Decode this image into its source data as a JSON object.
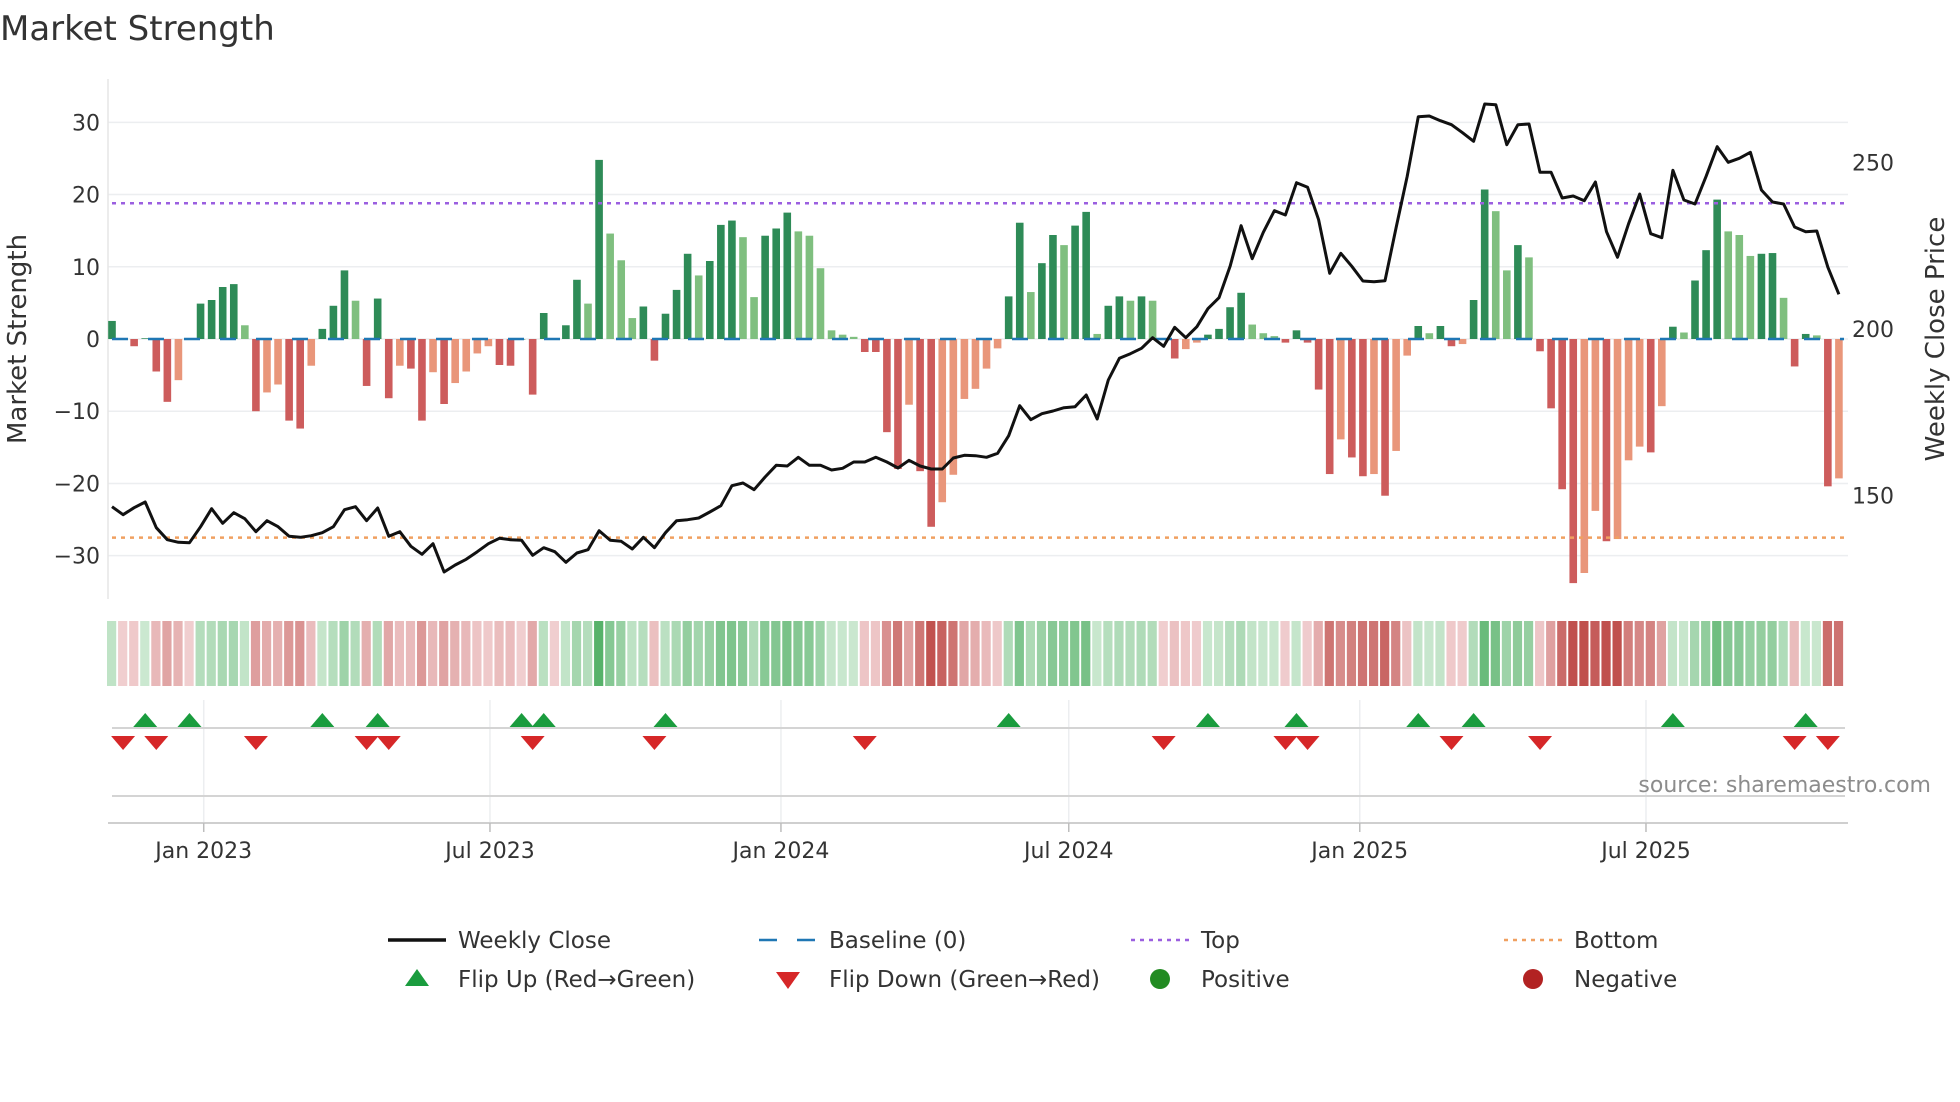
{
  "title": "Market Strength",
  "source": "source: sharemaestro.com",
  "chart_data": {
    "type": "bar",
    "title": "Market Strength",
    "start_date": "2022-11-04",
    "frequency": "weekly",
    "ylabel": "Market Strength",
    "y2label": "Weekly Close Price",
    "ylim": [
      -36,
      36
    ],
    "y2lim": [
      119,
      275
    ],
    "yticks": [
      30,
      20,
      10,
      0,
      -10,
      -20,
      -30
    ],
    "ytick_labels": [
      "30",
      "20",
      "10",
      "0",
      "−10",
      "−20",
      "−30"
    ],
    "y2ticks": [
      250,
      200,
      150
    ],
    "y2tick_labels": [
      "250",
      "200",
      "150"
    ],
    "xticks": [
      {
        "date": "2023-01-01",
        "label": "Jan 2023"
      },
      {
        "date": "2023-07-01",
        "label": "Jul 2023"
      },
      {
        "date": "2024-01-01",
        "label": "Jan 2024"
      },
      {
        "date": "2024-07-01",
        "label": "Jul 2024"
      },
      {
        "date": "2025-01-01",
        "label": "Jan 2025"
      },
      {
        "date": "2025-07-01",
        "label": "Jul 2025"
      }
    ],
    "top_level": 18.8,
    "bottom_level": -27.5,
    "baseline": 0,
    "grid": true,
    "legend_position": "bottom",
    "strength": [
      2.5,
      0,
      -1,
      0.1,
      -4.5,
      -8.7,
      -5.7,
      0,
      4.9,
      5.4,
      7.2,
      7.6,
      1.9,
      -10,
      -7.4,
      -6.3,
      -11.3,
      -12.4,
      -3.7,
      1.4,
      4.6,
      9.5,
      5.3,
      -6.5,
      5.6,
      -8.2,
      -3.7,
      -4.1,
      -11.3,
      -4.6,
      -9,
      -6.1,
      -4.5,
      -2,
      -1,
      -3.6,
      -3.7,
      0,
      -7.7,
      3.6,
      0,
      1.9,
      8.2,
      4.9,
      24.8,
      14.6,
      10.9,
      2.9,
      4.5,
      -3,
      3.5,
      6.8,
      11.8,
      8.8,
      10.8,
      15.8,
      16.4,
      14.1,
      5.8,
      14.3,
      15.3,
      17.5,
      14.9,
      14.3,
      9.8,
      1.2,
      0.6,
      0.3,
      -1.8,
      -1.8,
      -12.9,
      -18,
      -9.1,
      -18.3,
      -26,
      -22.6,
      -18.8,
      -8.3,
      -6.9,
      -4.1,
      -1.3,
      5.9,
      16.1,
      6.5,
      10.5,
      14.4,
      13,
      15.7,
      17.6,
      0.7,
      4.6,
      5.9,
      5.3,
      5.9,
      5.3,
      0,
      -2.7,
      -1.4,
      -0.5,
      0.6,
      1.4,
      4.4,
      6.4,
      2,
      0.8,
      0.4,
      -0.5,
      1.2,
      -0.5,
      -7,
      -18.7,
      -13.9,
      -16.4,
      -19,
      -18.7,
      -21.7,
      -15.5,
      -2.3,
      1.8,
      0.8,
      1.8,
      -1,
      -0.7,
      5.4,
      20.7,
      17.7,
      9.5,
      13,
      11.3,
      -1.7,
      -9.6,
      -20.8,
      -33.8,
      -32.4,
      -23.8,
      -28,
      -27.7,
      -16.8,
      -14.9,
      -15.7,
      -9.3,
      1.7,
      0.9,
      8.1,
      12.3,
      19.3,
      14.9,
      14.4,
      11.5,
      11.8,
      11.9,
      5.7,
      -3.8,
      0.7,
      0.5,
      -20.4,
      -19.3
    ],
    "weekly_close": [
      146.7,
      144.3,
      146.4,
      148.1,
      140.4,
      136.8,
      136.0,
      135.9,
      140.7,
      146.1,
      141.7,
      144.9,
      143.1,
      139.2,
      142.5,
      140.7,
      137.8,
      137.5,
      138.0,
      138.9,
      140.7,
      145.8,
      146.7,
      142.5,
      146.3,
      137.8,
      139.2,
      134.8,
      132.4,
      135.6,
      127.1,
      129.2,
      130.9,
      133.2,
      135.6,
      137.2,
      136.8,
      136.6,
      132.1,
      134.4,
      133.2,
      130.0,
      132.8,
      133.8,
      139.5,
      136.6,
      136.3,
      134.0,
      137.5,
      134.4,
      138.9,
      142.5,
      142.8,
      143.3,
      145.1,
      147.0,
      153.0,
      153.8,
      151.8,
      155.6,
      159.1,
      158.9,
      161.5,
      159.1,
      159.1,
      157.7,
      158.2,
      160.1,
      160.1,
      161.5,
      160.1,
      158.3,
      160.6,
      158.9,
      158.0,
      158.0,
      161.3,
      162.1,
      162.0,
      161.5,
      162.7,
      168.0,
      177.0,
      172.8,
      174.6,
      175.4,
      176.4,
      176.7,
      180.2,
      173.0,
      184.7,
      191.2,
      192.6,
      194.2,
      197.4,
      194.8,
      200.5,
      197.4,
      200.7,
      206.1,
      209.4,
      218.8,
      231.0,
      221.1,
      229.0,
      235.5,
      234.2,
      243.9,
      242.5,
      232.8,
      216.7,
      222.7,
      218.8,
      214.4,
      214.2,
      214.5,
      230.4,
      245.8,
      263.7,
      263.9,
      262.5,
      261.3,
      258.9,
      256.3,
      267.5,
      267.3,
      255.3,
      261.3,
      261.5,
      247.0,
      247.0,
      239.3,
      239.9,
      238.5,
      244.1,
      229.2,
      221.5,
      231.6,
      240.5,
      228.6,
      227.4,
      247.6,
      238.7,
      237.5,
      245.8,
      254.7,
      250.0,
      251.2,
      253.0,
      241.7,
      238.1,
      237.5,
      230.6,
      229.2,
      229.4,
      218.5,
      210.4
    ],
    "flip_up_weeks": [
      4,
      8,
      20,
      25,
      38,
      40,
      51,
      82,
      100,
      108,
      119,
      124,
      142,
      154
    ],
    "flip_down_weeks": [
      2,
      5,
      14,
      24,
      26,
      39,
      50,
      69,
      96,
      107,
      109,
      122,
      130,
      153,
      156
    ],
    "legend": [
      {
        "label": "Weekly Close",
        "symbol": "line"
      },
      {
        "label": "Baseline (0)",
        "symbol": "dash"
      },
      {
        "label": "Top",
        "symbol": "dot-purple"
      },
      {
        "label": "Bottom",
        "symbol": "dot-orange"
      },
      {
        "label": "Flip Up (Red→Green)",
        "symbol": "triangle-up"
      },
      {
        "label": "Flip Down (Green→Red)",
        "symbol": "triangle-down"
      },
      {
        "label": "Positive",
        "symbol": "circle-green"
      },
      {
        "label": "Negative",
        "symbol": "circle-red"
      }
    ],
    "colors": {
      "pos_strong": "#2e8b57",
      "pos_weak": "#7fbf7f",
      "neg_strong": "#cd5c5c",
      "neg_weak": "#e9967a",
      "close": "#111111",
      "baseline": "#1f77b4",
      "top": "#9b5fe0",
      "bottom": "#f0a060",
      "flip_up": "#1a9c3e",
      "flip_down": "#d62728",
      "positive": "#228b22",
      "negative": "#b22222"
    }
  }
}
